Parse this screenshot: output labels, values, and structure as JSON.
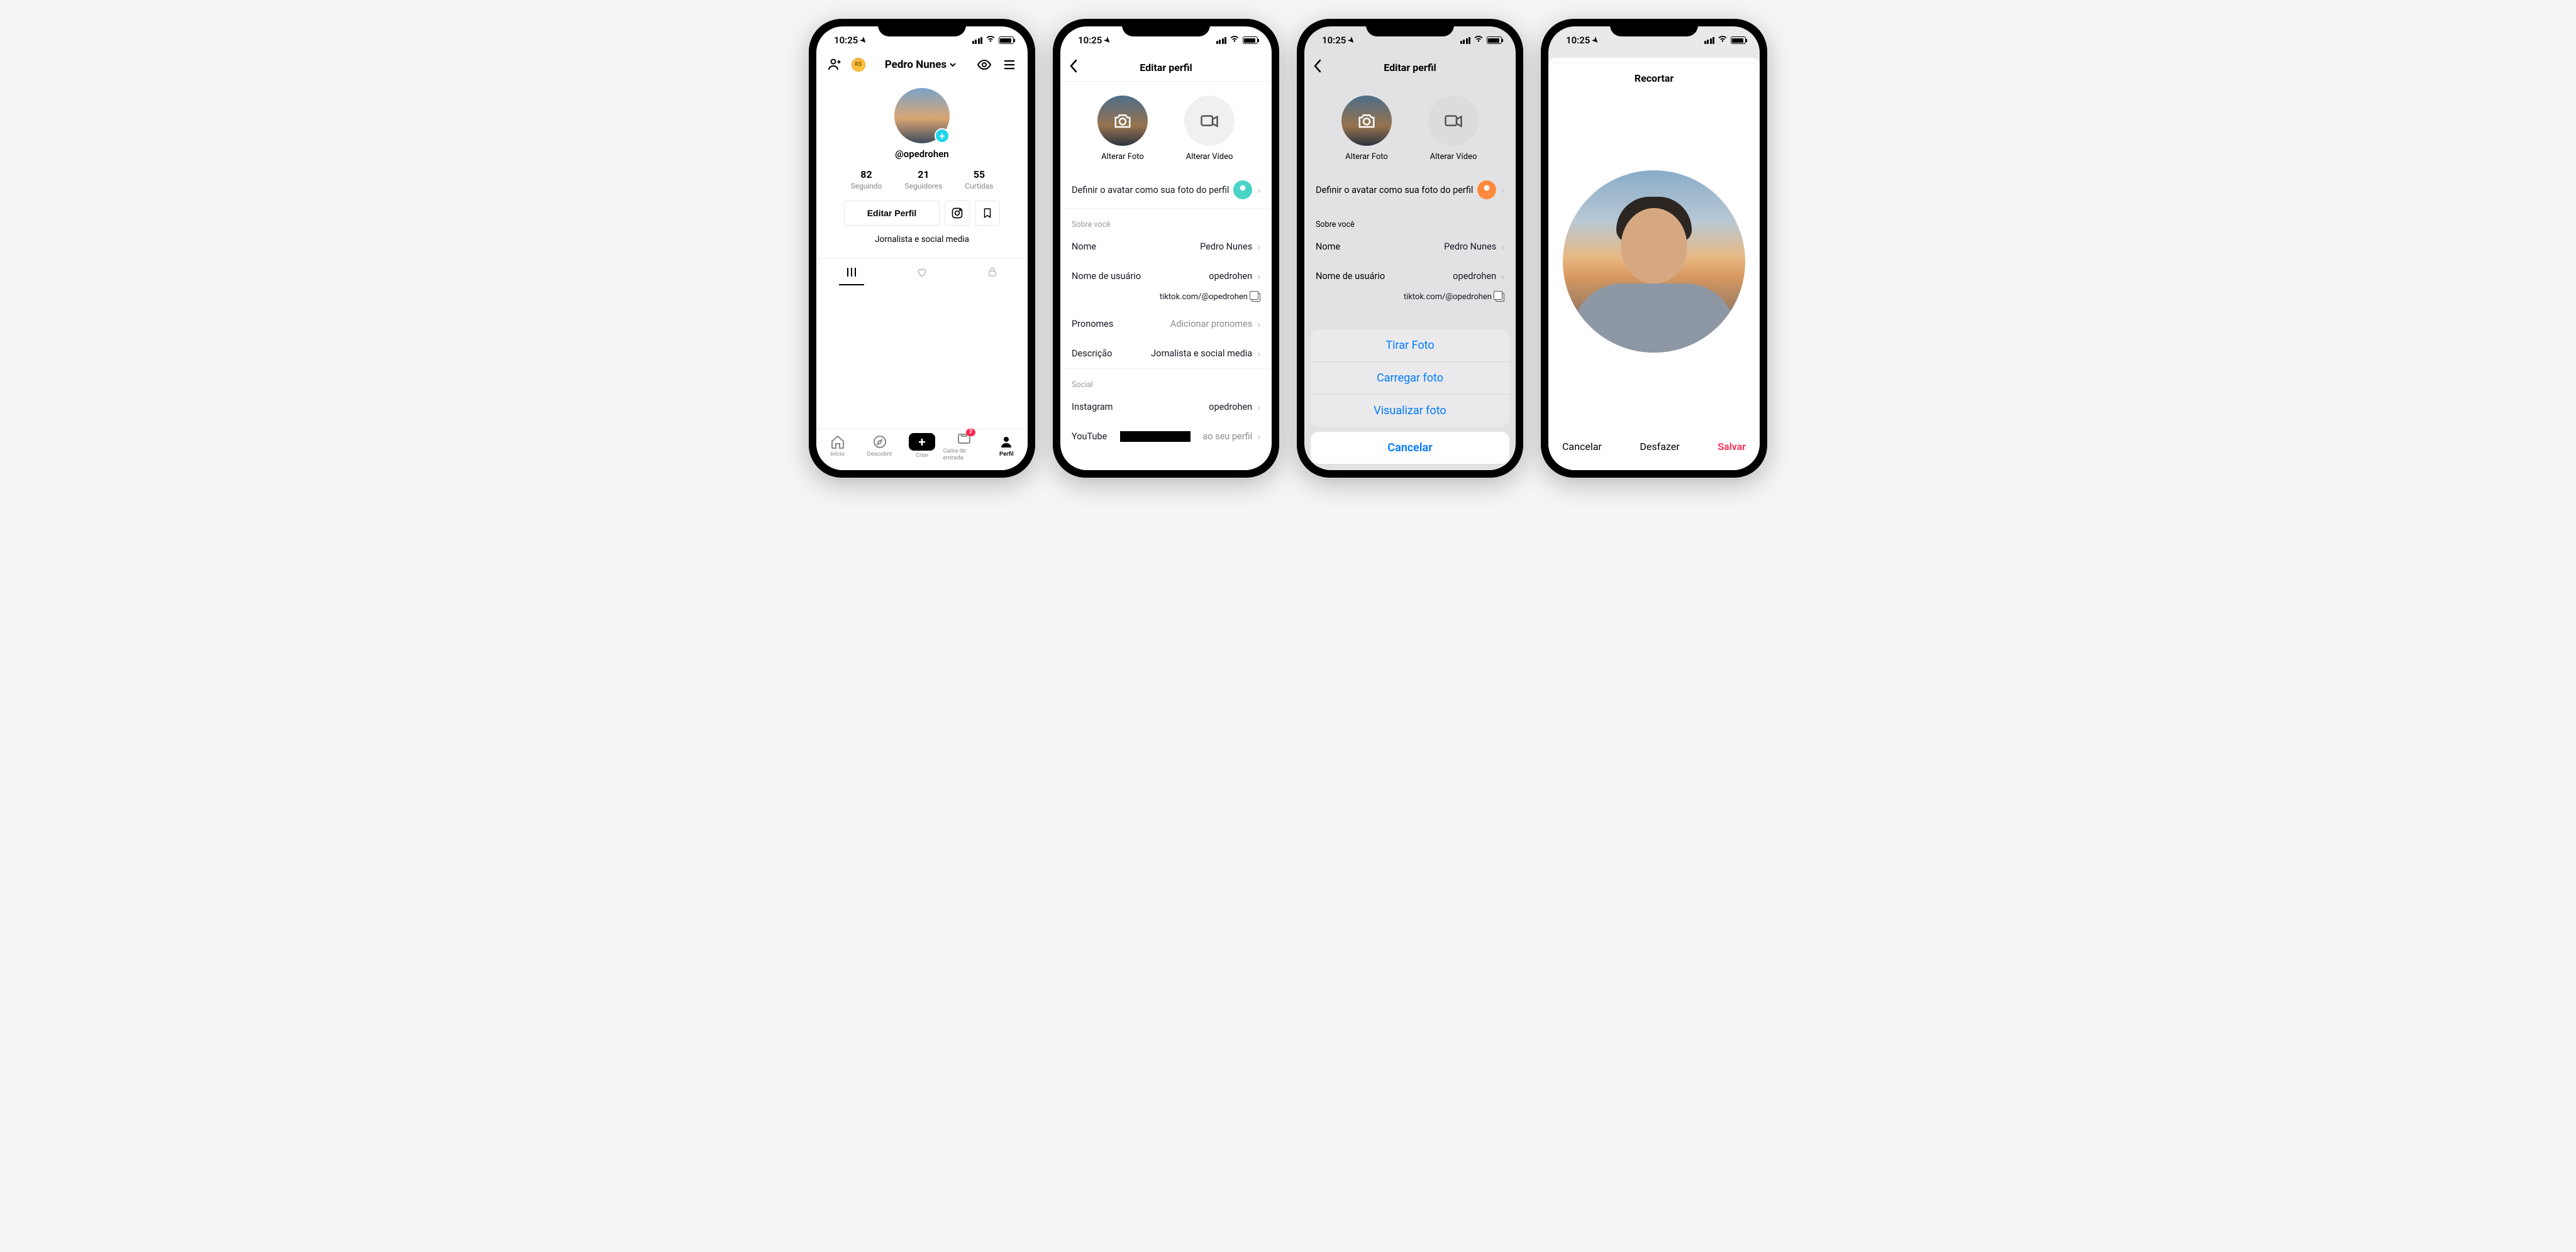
{
  "status": {
    "time": "10:25"
  },
  "phone1": {
    "name": "Pedro Nunes",
    "username": "@opedrohen",
    "stats": {
      "following": {
        "num": "82",
        "label": "Seguindo"
      },
      "followers": {
        "num": "21",
        "label": "Seguidores"
      },
      "likes": {
        "num": "55",
        "label": "Curtidas"
      }
    },
    "edit_btn": "Editar Perfil",
    "bio": "Jornalista e social media",
    "tabbar": {
      "home": "Início",
      "discover": "Descobrir",
      "create": "Criar",
      "inbox": "Caixa de entrada",
      "inbox_badge": "7",
      "profile": "Perfil"
    }
  },
  "phone2": {
    "title": "Editar perfil",
    "change_photo": "Alterar Foto",
    "change_video": "Alterar Vídeo",
    "avatar_row": "Definir o avatar como sua foto do perfil",
    "section_about": "Sobre você",
    "name_label": "Nome",
    "name_value": "Pedro Nunes",
    "user_label": "Nome de usuário",
    "user_value": "opedrohen",
    "url": "tiktok.com/@opedrohen",
    "pronoun_label": "Pronomes",
    "pronoun_value": "Adicionar pronomes",
    "desc_label": "Descrição",
    "desc_value": "Jornalista e social media",
    "section_social": "Social",
    "instagram_label": "Instagram",
    "instagram_value": "opedrohen",
    "youtube_label": "YouTube",
    "youtube_value": "ao seu perfil"
  },
  "phone3": {
    "title": "Editar perfil",
    "sheet": {
      "take": "Tirar Foto",
      "upload": "Carregar foto",
      "view": "Visualizar foto",
      "cancel": "Cancelar"
    }
  },
  "phone4": {
    "title": "Recortar",
    "cancel": "Cancelar",
    "undo": "Desfazer",
    "save": "Salvar"
  }
}
